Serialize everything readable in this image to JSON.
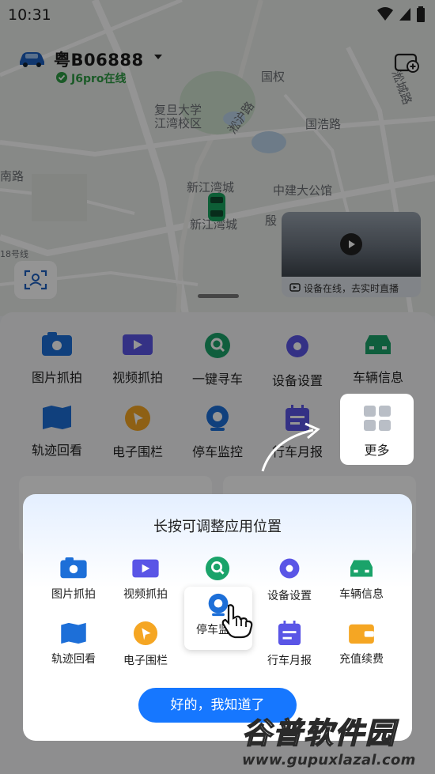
{
  "status_bar": {
    "time": "10:31"
  },
  "header": {
    "plate": "粤B06888",
    "online_status": "J6pro在线"
  },
  "map": {
    "labels": [
      "复旦大学",
      "江湾校区",
      "淞沪路",
      "国浩路",
      "中建大公馆",
      "新江湾城",
      "新江湾城",
      "殷",
      "号线",
      "国权",
      "南路",
      "淞城路",
      "18号线"
    ]
  },
  "live_preview": {
    "caption": "设备在线，去实时直播"
  },
  "function_grid": {
    "row1": [
      "图片抓拍",
      "视频抓拍",
      "一键寻车",
      "设备设置",
      "车辆信息"
    ],
    "row2": [
      "轨迹回看",
      "电子围栏",
      "停车监控",
      "行车月报"
    ],
    "more_label": "更多"
  },
  "dialog": {
    "title": "长按可调整应用位置",
    "row1": [
      "图片抓拍",
      "视频抓拍",
      "",
      "设备设置",
      "车辆信息"
    ],
    "dragged_label": "停车监控",
    "row2": [
      "轨迹回看",
      "电子围栏",
      "",
      "行车月报",
      "充值续费"
    ],
    "confirm_button": "好的，我知道了"
  },
  "watermark": {
    "brand": "谷普软件园",
    "url": "www.gupuxlazal.com"
  },
  "colors": {
    "accent_blue": "#1677ff",
    "online_green": "#2e9b44",
    "icon_blue": "#1d6fd8",
    "icon_purple": "#5a55e6",
    "icon_green": "#1aa36a",
    "icon_orange": "#f5a623"
  }
}
